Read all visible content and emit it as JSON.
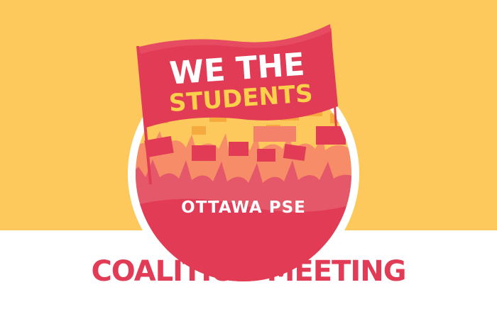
{
  "logo": {
    "banner_line_1": "WE THE",
    "banner_line_2": "STUDENTS",
    "location_label": "OTTAWA PSE"
  },
  "headline": "COALITION MEETING",
  "colors": {
    "background_yellow": "#fdc95c",
    "brand_red": "#e23b55",
    "banner_text_yellow": "#fbd04a",
    "white": "#ffffff"
  }
}
